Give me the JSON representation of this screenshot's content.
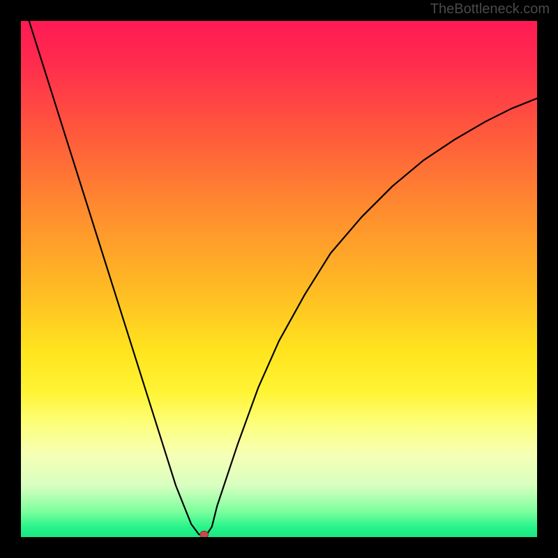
{
  "watermark": "TheBottleneck.com",
  "chart_data": {
    "type": "line",
    "title": "",
    "xlabel": "",
    "ylabel": "",
    "xlim": [
      0,
      100
    ],
    "ylim": [
      0,
      100
    ],
    "grid": false,
    "series": [
      {
        "name": "bottleneck-curve",
        "x": [
          0,
          3,
          6,
          9,
          12,
          15,
          18,
          21,
          24,
          27,
          30,
          33,
          34.5,
          36,
          37,
          38,
          42,
          46,
          50,
          55,
          60,
          66,
          72,
          78,
          84,
          90,
          95,
          100
        ],
        "values": [
          105,
          95.5,
          86,
          76.5,
          67,
          57.5,
          48,
          38.5,
          29,
          19.5,
          10,
          2.5,
          0.5,
          0.5,
          2,
          6,
          18,
          29,
          38,
          47,
          55,
          62,
          68,
          73,
          77,
          80.5,
          83,
          85
        ]
      }
    ],
    "marker": {
      "x": 35.5,
      "y": 0.5,
      "name": "optimal-point"
    },
    "background": {
      "type": "vertical-gradient",
      "stops": [
        {
          "pos": 0,
          "color": "#ff1a55"
        },
        {
          "pos": 8,
          "color": "#ff2b4d"
        },
        {
          "pos": 22,
          "color": "#ff5a3c"
        },
        {
          "pos": 36,
          "color": "#ff8a2f"
        },
        {
          "pos": 52,
          "color": "#ffbb24"
        },
        {
          "pos": 64,
          "color": "#ffe41e"
        },
        {
          "pos": 72,
          "color": "#fff435"
        },
        {
          "pos": 78,
          "color": "#fdff7a"
        },
        {
          "pos": 84,
          "color": "#f6ffb5"
        },
        {
          "pos": 90,
          "color": "#d8ffc0"
        },
        {
          "pos": 95,
          "color": "#7eff9e"
        },
        {
          "pos": 98,
          "color": "#29f48a"
        },
        {
          "pos": 100,
          "color": "#18e884"
        }
      ]
    }
  }
}
